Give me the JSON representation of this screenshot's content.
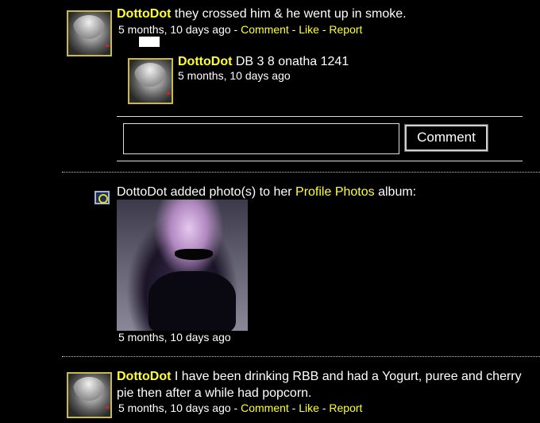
{
  "posts": [
    {
      "author": "DottoDot",
      "text": "they crossed him & he went up in smoke.",
      "time": "5 months, 10 days ago",
      "sep": " - ",
      "actions": [
        "Comment",
        "Like",
        "Report"
      ]
    },
    {
      "author": "DottoDot",
      "text": "I have been drinking RBB and had a Yogurt, puree and cherry pie then after a while had popcorn.",
      "time": "5 months, 10 days ago",
      "sep": " - ",
      "actions": [
        "Comment",
        "Like",
        "Report"
      ]
    }
  ],
  "reply": {
    "author": "DottoDot",
    "text": "DB 3 8 onatha 1241",
    "time": "5 months, 10 days ago"
  },
  "comment_form": {
    "input_value": "",
    "button_label": "Comment"
  },
  "activity": {
    "prefix": "DottoDot added photo(s) to her",
    "album_link": "Profile Photos",
    "suffix": "album:",
    "time": "5 months, 10 days ago"
  }
}
